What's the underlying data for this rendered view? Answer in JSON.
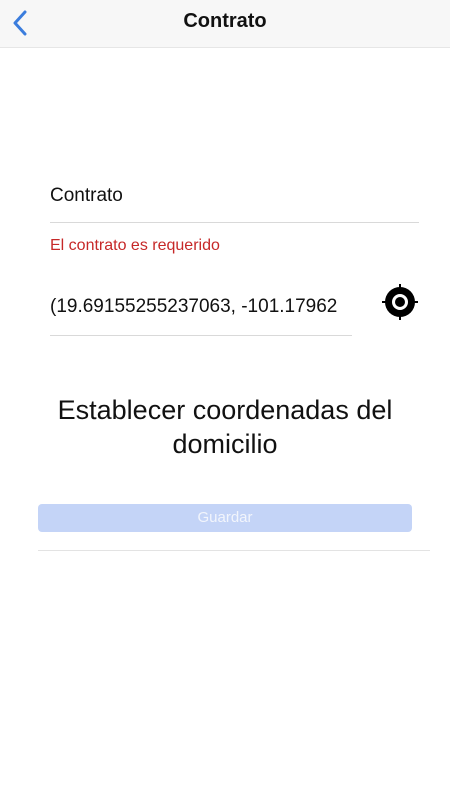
{
  "navbar": {
    "title": "Contrato",
    "back_icon": "chevron-left-icon",
    "accent_color": "#3b7ddd"
  },
  "form": {
    "contrato": {
      "placeholder": "Contrato",
      "value": ""
    },
    "contrato_error": "El contrato es requerido",
    "error_color": "#c62828",
    "coordinates": {
      "value": "(19.69155255237063, -101.17962"
    },
    "locate_icon": "crosshair-target-icon"
  },
  "heading": "Establecer coordenadas del domicilio",
  "save_button": {
    "label": "Guardar",
    "state": "disabled",
    "color": "#c4d4f7"
  }
}
